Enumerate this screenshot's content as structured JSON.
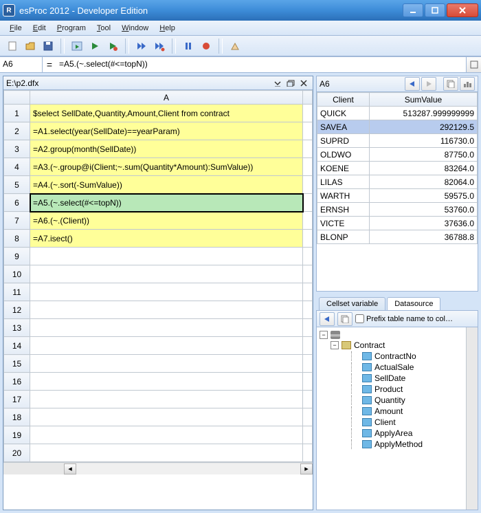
{
  "titlebar": {
    "title": "esProc 2012 - Developer Edition"
  },
  "menus": {
    "file": "File",
    "edit": "Edit",
    "program": "Program",
    "tool": "Tool",
    "window": "Window",
    "help": "Help"
  },
  "formula": {
    "cellref": "A6",
    "eq": "=",
    "content": "=A5.(~.select(#<=topN))"
  },
  "document": {
    "filename": "E:\\p2.dfx"
  },
  "column_header": "A",
  "cells": [
    {
      "row": 1,
      "text": "$select SellDate,Quantity,Amount,Client from contract",
      "filled": true
    },
    {
      "row": 2,
      "text": "=A1.select(year(SellDate)==yearParam)",
      "filled": true
    },
    {
      "row": 3,
      "text": "=A2.group(month(SellDate))",
      "filled": true
    },
    {
      "row": 4,
      "text": "=A3.(~.group@i(Client;~.sum(Quantity*Amount):SumValue))",
      "filled": true
    },
    {
      "row": 5,
      "text": "=A4.(~.sort(-SumValue))",
      "filled": true
    },
    {
      "row": 6,
      "text": "=A5.(~.select(#<=topN))",
      "filled": true,
      "selected": true
    },
    {
      "row": 7,
      "text": "=A6.(~.(Client))",
      "filled": true
    },
    {
      "row": 8,
      "text": "=A7.isect()",
      "filled": true
    },
    {
      "row": 9,
      "text": ""
    },
    {
      "row": 10,
      "text": ""
    },
    {
      "row": 11,
      "text": ""
    },
    {
      "row": 12,
      "text": ""
    },
    {
      "row": 13,
      "text": ""
    },
    {
      "row": 14,
      "text": ""
    },
    {
      "row": 15,
      "text": ""
    },
    {
      "row": 16,
      "text": ""
    },
    {
      "row": 17,
      "text": ""
    },
    {
      "row": 18,
      "text": ""
    },
    {
      "row": 19,
      "text": ""
    },
    {
      "row": 20,
      "text": ""
    }
  ],
  "result": {
    "ref": "A6",
    "columns": [
      "Client",
      "SumValue"
    ],
    "rows": [
      {
        "client": "QUICK",
        "sum": "513287.999999999"
      },
      {
        "client": "SAVEA",
        "sum": "292129.5",
        "selected": true
      },
      {
        "client": "SUPRD",
        "sum": "116730.0"
      },
      {
        "client": "OLDWO",
        "sum": "87750.0"
      },
      {
        "client": "KOENE",
        "sum": "83264.0"
      },
      {
        "client": "LILAS",
        "sum": "82064.0"
      },
      {
        "client": "WARTH",
        "sum": "59575.0"
      },
      {
        "client": "ERNSH",
        "sum": "53760.0"
      },
      {
        "client": "VICTE",
        "sum": "37636.0"
      },
      {
        "client": "BLONP",
        "sum": "36788.8"
      }
    ]
  },
  "tabs": {
    "cellset": "Cellset variable",
    "datasource": "Datasource"
  },
  "ds": {
    "prefix_label": "Prefix table name to col…",
    "tree": {
      "table": "Contract",
      "columns": [
        "ContractNo",
        "ActualSale",
        "SellDate",
        "Product",
        "Quantity",
        "Amount",
        "Client",
        "ApplyArea",
        "ApplyMethod"
      ]
    }
  }
}
